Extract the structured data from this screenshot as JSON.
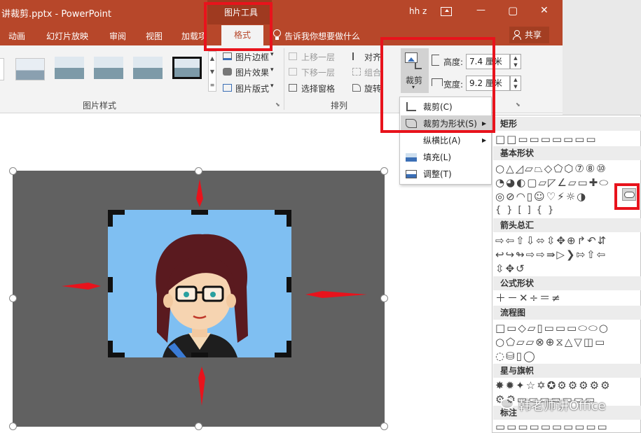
{
  "window": {
    "title": "讲裁剪.pptx  -  PowerPoint",
    "context_group": "图片工具",
    "user": "hh z",
    "minimize_glyph": "—",
    "restore_glyph": "▢",
    "close_glyph": "✕"
  },
  "tabs": [
    "动画",
    "幻灯片放映",
    "审阅",
    "视图",
    "加载项",
    "格式"
  ],
  "tell_me": "告诉我你想要做什么",
  "share": "共享",
  "ribbon": {
    "picture_border": "图片边框",
    "picture_effects": "图片效果",
    "picture_layout": "图片版式",
    "picture_styles_group": "图片样式",
    "bring_forward": "上移一层",
    "send_backward": "下移一层",
    "selection_pane": "选择窗格",
    "align": "对齐",
    "group": "组合",
    "rotate": "旋转",
    "arrange_group": "排列",
    "crop": "裁剪",
    "height_label": "高度:",
    "height_value": "7.4 厘米",
    "width_label": "宽度:",
    "width_value": "9.2 厘米"
  },
  "crop_menu": {
    "items": [
      "裁剪(C)",
      "裁剪为形状(S)",
      "纵横比(A)",
      "填充(L)",
      "调整(T)"
    ],
    "highlighted": "裁剪为形状(S)"
  },
  "shapes_panel": {
    "categories": [
      "矩形",
      "基本形状",
      "箭头总汇",
      "公式形状",
      "流程图",
      "星与旗帜",
      "标注"
    ]
  },
  "watermark": "韩老师讲Office",
  "colors": {
    "accent": "#b7472a",
    "highlight": "#e8131c",
    "photo_bg": "#7fbff2",
    "crop_frame": "#616161"
  }
}
